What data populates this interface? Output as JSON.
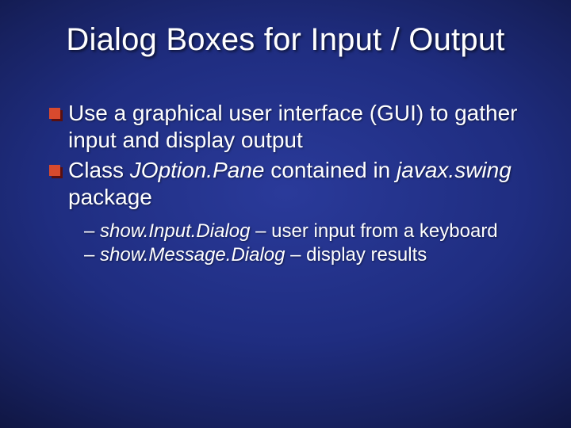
{
  "title": "Dialog Boxes for Input / Output",
  "bullets": [
    {
      "text": "Use a graphical user interface (GUI) to gather input and display output"
    },
    {
      "prefix": "Class ",
      "class_name": "JOption.Pane",
      "mid": " contained in ",
      "package_name": "javax.swing",
      "suffix": " package"
    }
  ],
  "subitems": [
    {
      "dash": "– ",
      "method": "show.Input.Dialog",
      "sep": " – ",
      "desc": "user input from a keyboard"
    },
    {
      "dash": "– ",
      "method": "show.Message.Dialog",
      "sep": " – ",
      "desc": "display results"
    }
  ]
}
